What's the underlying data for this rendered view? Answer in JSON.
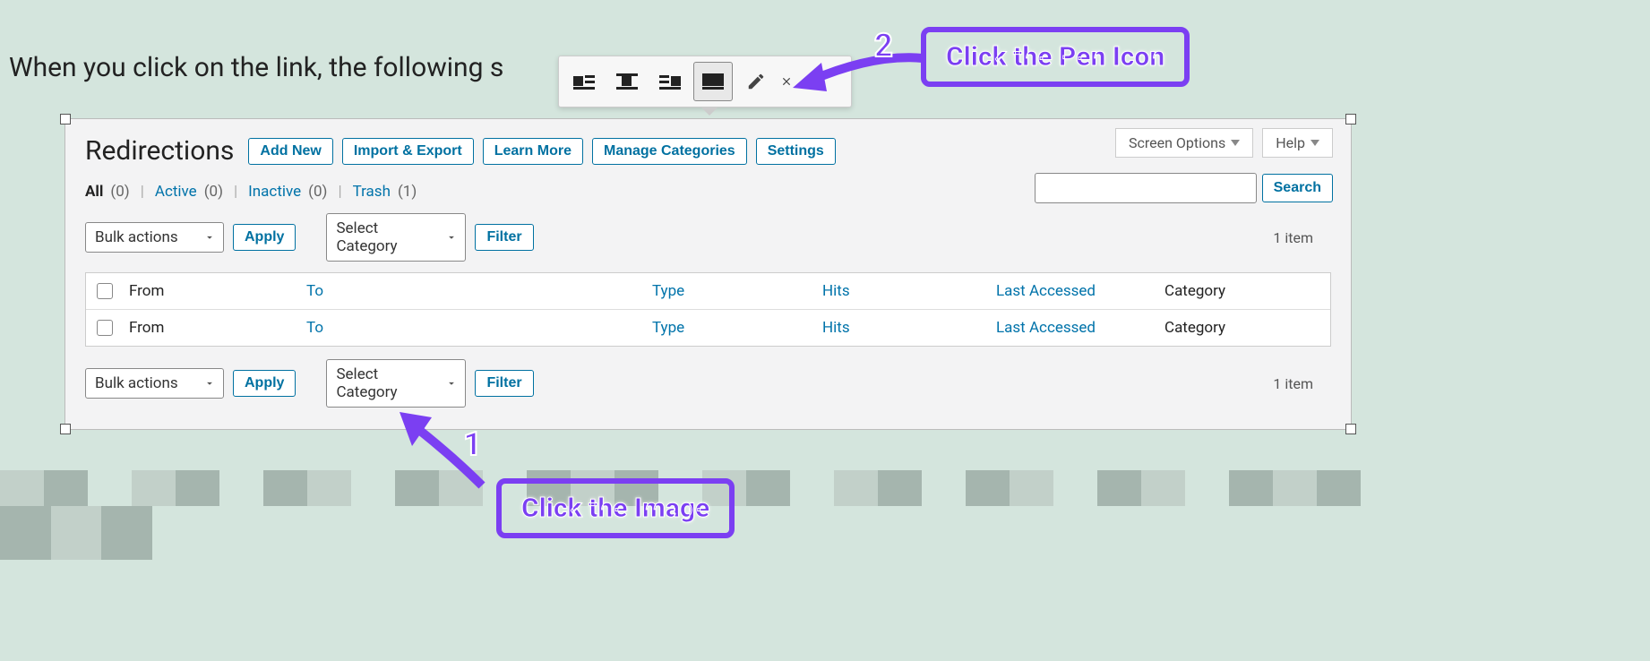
{
  "intro_text": "When you click on the link, the following s",
  "top_right": {
    "screen_options": "Screen Options",
    "help": "Help"
  },
  "page": {
    "title": "Redirections",
    "actions": {
      "add_new": "Add New",
      "import_export": "Import & Export",
      "learn_more": "Learn More",
      "manage_categories": "Manage Categories",
      "settings": "Settings"
    }
  },
  "filters": {
    "all_label": "All",
    "all_count": "(0)",
    "active_label": "Active",
    "active_count": "(0)",
    "inactive_label": "Inactive",
    "inactive_count": "(0)",
    "trash_label": "Trash",
    "trash_count": "(1)"
  },
  "search": {
    "button": "Search"
  },
  "toolbar": {
    "bulk": "Bulk actions",
    "apply": "Apply",
    "category": "Select Category",
    "filter": "Filter",
    "item_count": "1 item"
  },
  "columns": {
    "from": "From",
    "to": "To",
    "type": "Type",
    "hits": "Hits",
    "last_accessed": "Last Accessed",
    "category": "Category"
  },
  "callouts": {
    "step1_num": "1",
    "step1_text": "Click the Image",
    "step2_num": "2",
    "step2_text": "Click the Pen Icon"
  }
}
